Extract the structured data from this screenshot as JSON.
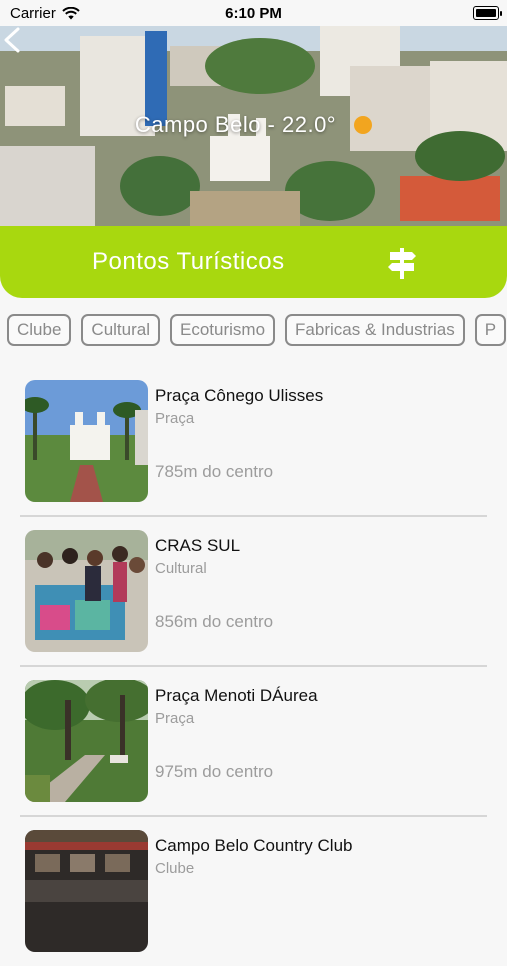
{
  "status_bar": {
    "carrier": "Carrier",
    "time": "6:10 PM"
  },
  "hero": {
    "title": "Campo Belo - 22.0°",
    "weather_icon": "sun-icon"
  },
  "header": {
    "title": "Pontos Turísticos",
    "icon": "signpost-icon",
    "accent": "#a8d80f"
  },
  "chips": [
    "Clube",
    "Cultural",
    "Ecoturismo",
    "Fabricas & Industrias",
    "P"
  ],
  "places": [
    {
      "name": "Praça Cônego Ulisses",
      "category": "Praça",
      "distance": "785m do centro"
    },
    {
      "name": "CRAS SUL",
      "category": "Cultural",
      "distance": "856m do centro"
    },
    {
      "name": "Praça Menoti DÁurea",
      "category": "Praça",
      "distance": "975m do centro"
    },
    {
      "name": "Campo Belo Country Club",
      "category": "Clube",
      "distance": ""
    }
  ]
}
